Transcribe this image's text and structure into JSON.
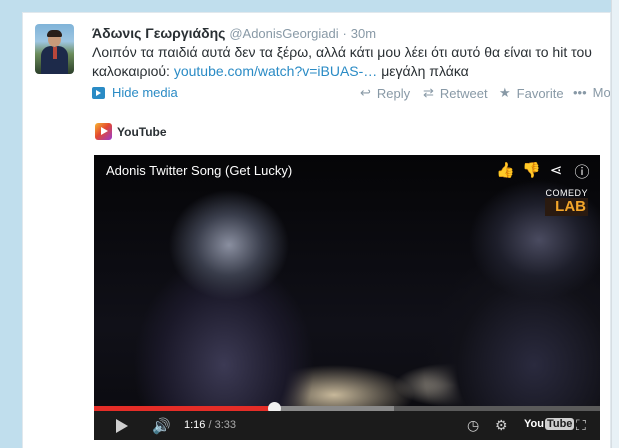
{
  "tweet": {
    "fullname": "Άδωνις Γεωργιάδης",
    "handle": "@AdonisGeorgiadi",
    "separator": "·",
    "time": "30m",
    "text_part1": "Λοιπόν τα παιδιά αυτά δεν τα ξέρω, αλλά κάτι μου λέει ότι αυτό θα είναι το hit του καλοκαιριού: ",
    "link": "youtube.com/watch?v=iBUAS-…",
    "text_part2": " μεγάλη πλάκα"
  },
  "actions": {
    "hide_media": "Hide media",
    "reply": "Reply",
    "retweet": "Retweet",
    "favorite": "Favorite",
    "more": "More"
  },
  "media_source": "YouTube",
  "player": {
    "title": "Adonis Twitter Song (Get Lucky)",
    "brand_line1": "COMEDY",
    "brand_line2": "LAB",
    "current_time": "1:16",
    "separator": " / ",
    "duration": "3:33",
    "progress_fraction": 0.356,
    "logo_text": "You",
    "logo_text2": "Tube"
  },
  "icons": {
    "like": "thumbs-up-icon",
    "dislike": "thumbs-down-icon",
    "share": "share-icon",
    "info": "info-icon"
  },
  "colors": {
    "link": "#2a8bc5",
    "progress": "#e52d27",
    "background": "#c0deed"
  }
}
